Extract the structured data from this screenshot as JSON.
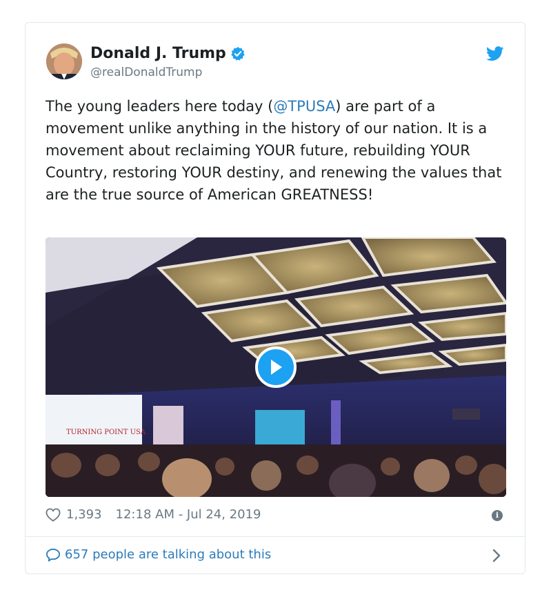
{
  "tweet": {
    "author": {
      "name": "Donald J. Trump",
      "handle": "@realDonaldTrump"
    },
    "text": {
      "part1": "The young leaders here today (",
      "mention": "@TPUSA",
      "part2": ") are part of a movement unlike anything in the history of our nation. It is a movement about reclaiming YOUR future, rebuilding YOUR Country, restoring YOUR destiny, and renewing the values that are the true source of American GREATNESS!"
    },
    "media": {
      "screen_text": "TURNING POINT USA"
    },
    "likes": "1,393",
    "timestamp": "12:18 AM - Jul 24, 2019",
    "talking": "657 people are talking about this"
  },
  "colors": {
    "link": "#2b7bb9",
    "brand": "#1da1f2",
    "muted": "#697882"
  },
  "icons": [
    "verified-badge-icon",
    "twitter-bird-icon",
    "play-icon",
    "heart-icon",
    "info-icon",
    "comment-bubble-icon",
    "chevron-right-icon"
  ]
}
